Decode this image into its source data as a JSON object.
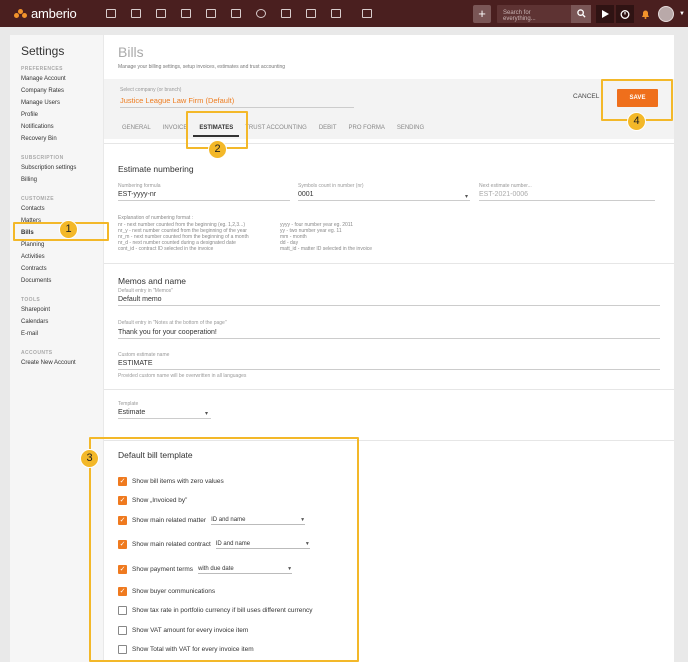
{
  "topbar": {
    "logo_text": "amberio",
    "search_placeholder": "Search for everything...",
    "plus_label": "+"
  },
  "sidebar": {
    "title": "Settings",
    "sections": [
      {
        "label": "PREFERENCES",
        "items": [
          "Manage Account",
          "Company Rates",
          "Manage Users",
          "Profile",
          "Notifications",
          "Recovery Bin"
        ]
      },
      {
        "label": "SUBSCRIPTION",
        "items": [
          "Subscription settings",
          "Billing"
        ]
      },
      {
        "label": "CUSTOMIZE",
        "items": [
          "Contacts",
          "Matters",
          "Bills",
          "Planning",
          "Activities",
          "Contracts",
          "Documents"
        ]
      },
      {
        "label": "TOOLS",
        "items": [
          "Sharepoint",
          "Calendars",
          "E-mail"
        ]
      },
      {
        "label": "ACCOUNTS",
        "items": [
          "Create New Account"
        ]
      }
    ]
  },
  "header": {
    "title": "Bills",
    "subtitle": "Manage your billing settings, setup invoices, estimates and trust accounting",
    "company_label": "Select company (or branch)",
    "company_value": "Justice League Law Firm (Default)",
    "cancel": "CANCEL",
    "save": "SAVE"
  },
  "tabs": [
    "GENERAL",
    "INVOICE",
    "ESTIMATES",
    "TRUST ACCOUNTING",
    "DEBIT",
    "PRO FORMA",
    "SENDING"
  ],
  "estimate_numbering": {
    "title": "Estimate numbering",
    "formula_label": "Numbering formula",
    "formula_value": "EST-yyyy-nr",
    "symbols_label": "Symbols count in number (nr)",
    "symbols_value": "0001",
    "next_label": "Next estimate number...",
    "next_value": "EST-2021-0006",
    "expl_title": "Explanation of numbering format :",
    "expl_left": [
      "nr - next number counted from the beginning (eg. 1,2,3...)",
      "nr_y - next number counted from the beginning of the year",
      "nr_m - next number counted from the beginning of a month",
      "nr_d - next number counted during a designated date",
      "cont_id - contract ID selected in the invoice"
    ],
    "expl_right": [
      "yyyy - four number year eg. 2011",
      "yy - two number year eg. 11",
      "mm - month",
      "dd - day",
      "matt_id - matter ID selected in the invoice"
    ]
  },
  "memos": {
    "title": "Memos and name",
    "memo_label": "Default entry in \"Memos\"",
    "memo_value": "Default memo",
    "notes_label": "Default entry in \"Notes at the bottom of the page\"",
    "notes_value": "Thank you for your cooperation!",
    "custom_label": "Custom estimate name",
    "custom_value": "ESTIMATE",
    "custom_hint": "Provided custom name will be overwritten in all languages"
  },
  "template": {
    "label": "Template",
    "value": "Estimate"
  },
  "bill_template": {
    "title": "Default bill template",
    "items": [
      {
        "label": "Show bill items with zero values",
        "checked": true,
        "select": ""
      },
      {
        "label": "Show „Invoiced by”",
        "checked": true,
        "select": ""
      },
      {
        "label": "Show main related matter",
        "checked": true,
        "select": "ID and name"
      },
      {
        "label": "Show main related contract",
        "checked": true,
        "select": "ID and name"
      },
      {
        "label": "Show payment terms",
        "checked": true,
        "select": "with due date"
      },
      {
        "label": "Show buyer communications",
        "checked": true,
        "select": ""
      },
      {
        "label": "Show tax rate in portfolio currency if bill uses different currency",
        "checked": false,
        "select": ""
      },
      {
        "label": "Show VAT amount for every invoice item",
        "checked": false,
        "select": ""
      },
      {
        "label": "Show Total with VAT for every invoice item",
        "checked": false,
        "select": ""
      }
    ]
  },
  "callouts": [
    "1",
    "2",
    "3",
    "4"
  ],
  "colors": {
    "topbar": "#4a1f1f",
    "accent": "#ef6f1c",
    "callout": "#f3b829"
  }
}
